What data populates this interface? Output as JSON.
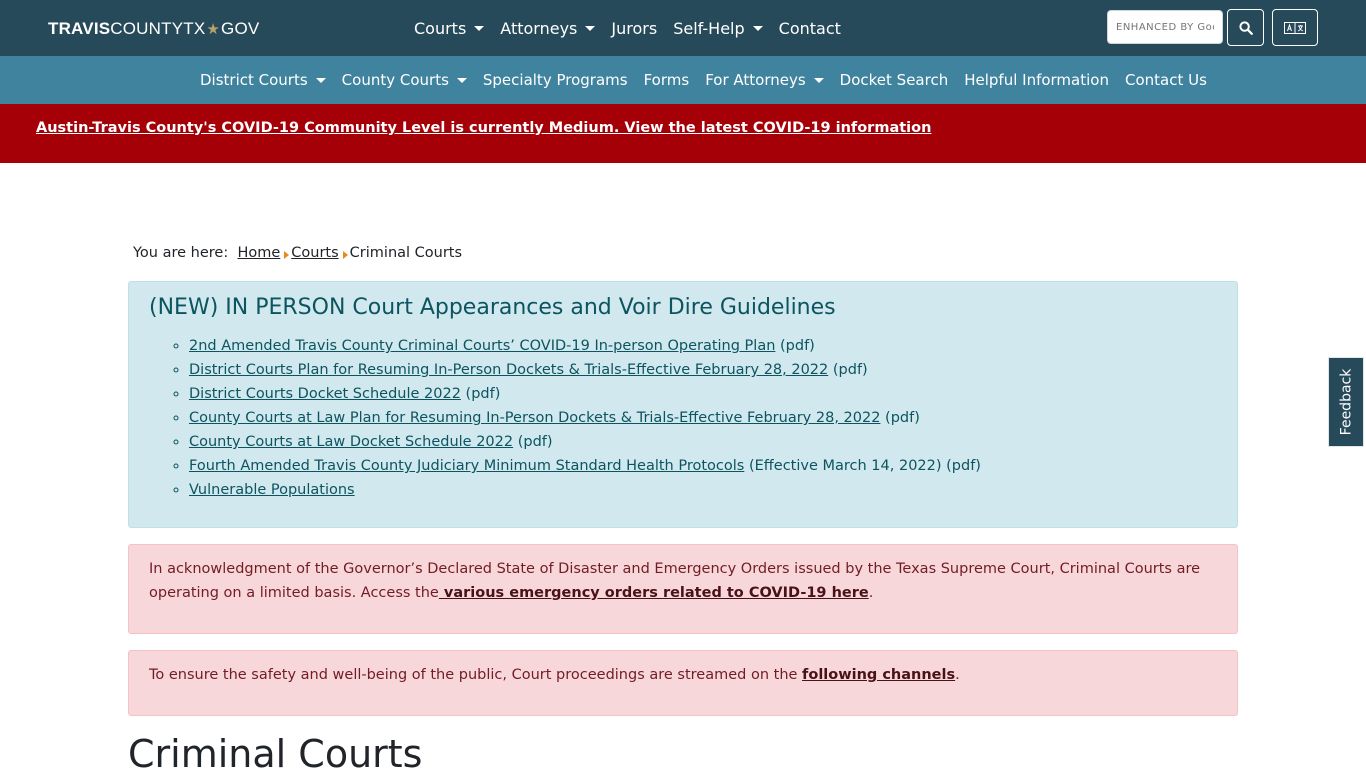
{
  "header": {
    "logo_part1": "TRAVIS",
    "logo_part2": "COUNTYTX",
    "logo_part3": "GOV",
    "nav": [
      {
        "label": "Courts",
        "dropdown": true
      },
      {
        "label": "Attorneys",
        "dropdown": true
      },
      {
        "label": "Jurors",
        "dropdown": false
      },
      {
        "label": "Self-Help",
        "dropdown": true
      },
      {
        "label": "Contact",
        "dropdown": false
      }
    ],
    "search_placeholder": "ENHANCED BY Google"
  },
  "subnav": [
    {
      "label": "District Courts",
      "dropdown": true
    },
    {
      "label": "County Courts",
      "dropdown": true
    },
    {
      "label": "Specialty Programs",
      "dropdown": false
    },
    {
      "label": "Forms",
      "dropdown": false
    },
    {
      "label": "For Attorneys",
      "dropdown": true
    },
    {
      "label": "Docket Search",
      "dropdown": false
    },
    {
      "label": "Helpful Information",
      "dropdown": false
    },
    {
      "label": "Contact Us",
      "dropdown": false
    }
  ],
  "covid_banner": "Austin-Travis County's COVID-19 Community Level is currently Medium. View the latest COVID-19 information",
  "breadcrumb": {
    "prefix": "You are here:",
    "home": "Home",
    "courts": "Courts",
    "current": "Criminal Courts"
  },
  "info": {
    "title": "(NEW) IN PERSON Court Appearances and Voir Dire Guidelines",
    "links": [
      {
        "text": "2nd Amended Travis County Criminal Courts’ COVID-19 In-person Operating Plan",
        "suffix": " (pdf)"
      },
      {
        "text": "District Courts Plan for Resuming In-Person Dockets & Trials-Effective February 28, 2022",
        "suffix": " (pdf)"
      },
      {
        "text": "District Courts Docket Schedule 2022",
        "suffix": " (pdf)"
      },
      {
        "text": "County Courts at Law Plan for Resuming In-Person Dockets & Trials-Effective February 28, 2022",
        "suffix": " (pdf)"
      },
      {
        "text": "County Courts at Law Docket Schedule 2022",
        "suffix": " (pdf)"
      },
      {
        "text": "Fourth Amended Travis County Judiciary Minimum Standard Health Protocols",
        "suffix": " (Effective March 14, 2022) (pdf)"
      },
      {
        "text": "Vulnerable Populations",
        "suffix": ""
      }
    ]
  },
  "alert1": {
    "text": "In acknowledgment of the Governor’s Declared State of Disaster and Emergency Orders issued by the Texas Supreme Court, Criminal Courts are operating on a limited basis. Access the",
    "link": " various emergency orders related to COVID-19 here",
    "after": "."
  },
  "alert2": {
    "text": "To ensure the safety and well-being of the public, Court proceedings are streamed on the ",
    "link": "following channels",
    "after": "."
  },
  "page_title": "Criminal Courts",
  "feedback": "Feedback",
  "icons": {
    "search": "search-icon",
    "translate": "translate-icon"
  }
}
